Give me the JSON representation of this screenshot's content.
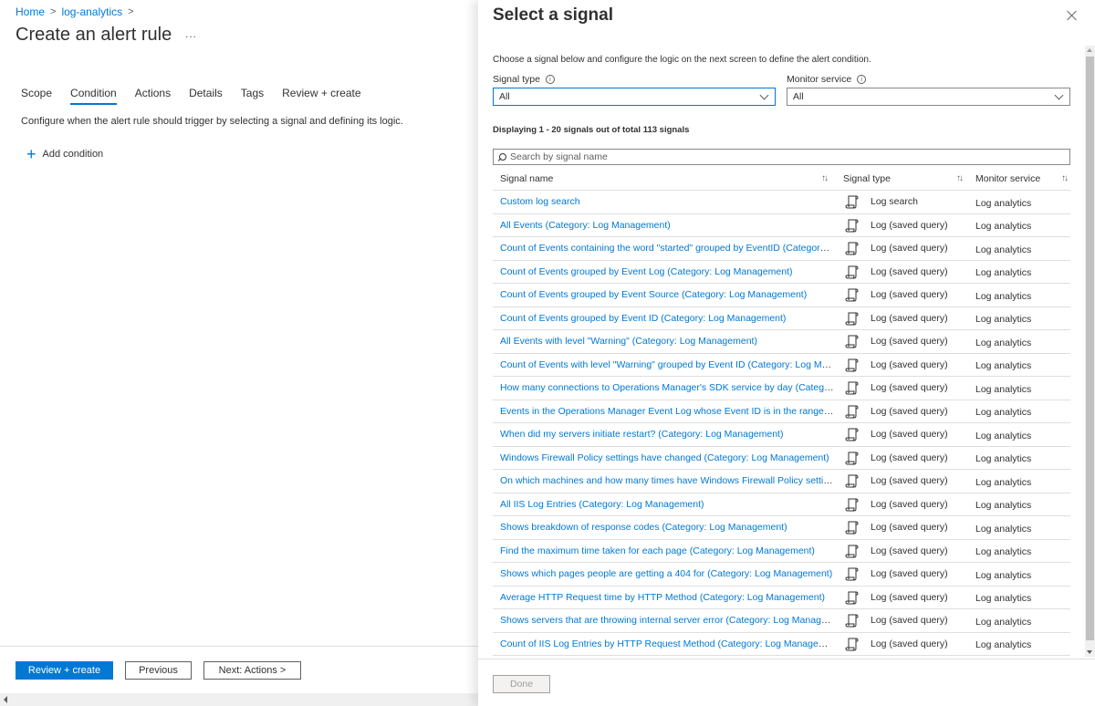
{
  "breadcrumb": [
    {
      "label": "Home"
    },
    {
      "label": "log-analytics"
    }
  ],
  "page": {
    "title": "Create an alert rule",
    "more_label": "...",
    "tabs": [
      {
        "label": "Scope",
        "active": false
      },
      {
        "label": "Condition",
        "active": true
      },
      {
        "label": "Actions",
        "active": false
      },
      {
        "label": "Details",
        "active": false
      },
      {
        "label": "Tags",
        "active": false
      },
      {
        "label": "Review + create",
        "active": false
      }
    ],
    "description": "Configure when the alert rule should trigger by selecting a signal and defining its logic.",
    "add_condition_label": "Add condition",
    "footer": {
      "review_create_label": "Review + create",
      "previous_label": "Previous",
      "next_label": "Next: Actions >"
    }
  },
  "panel": {
    "title": "Select a signal",
    "description": "Choose a signal below and configure the logic on the next screen to define the alert condition.",
    "signal_type": {
      "label": "Signal type",
      "value": "All"
    },
    "monitor_service": {
      "label": "Monitor service",
      "value": "All"
    },
    "count_text": "Displaying 1 - 20 signals out of total 113 signals",
    "search": {
      "placeholder": "Search by signal name",
      "value": ""
    },
    "columns": [
      "Signal name",
      "Signal type",
      "Monitor service"
    ],
    "rows": [
      {
        "name": "Custom log search",
        "type": "Log search",
        "service": "Log analytics"
      },
      {
        "name": "All Events (Category: Log Management)",
        "type": "Log (saved query)",
        "service": "Log analytics"
      },
      {
        "name": "Count of Events containing the word \"started\" grouped by EventID (Category: L...",
        "type": "Log (saved query)",
        "service": "Log analytics"
      },
      {
        "name": "Count of Events grouped by Event Log (Category: Log Management)",
        "type": "Log (saved query)",
        "service": "Log analytics"
      },
      {
        "name": "Count of Events grouped by Event Source (Category: Log Management)",
        "type": "Log (saved query)",
        "service": "Log analytics"
      },
      {
        "name": "Count of Events grouped by Event ID (Category: Log Management)",
        "type": "Log (saved query)",
        "service": "Log analytics"
      },
      {
        "name": "All Events with level \"Warning\" (Category: Log Management)",
        "type": "Log (saved query)",
        "service": "Log analytics"
      },
      {
        "name": "Count of Events with level \"Warning\" grouped by Event ID (Category: Log Man...",
        "type": "Log (saved query)",
        "service": "Log analytics"
      },
      {
        "name": "How many connections to Operations Manager's SDK service by day (Category:...",
        "type": "Log (saved query)",
        "service": "Log analytics"
      },
      {
        "name": "Events in the Operations Manager Event Log whose Event ID is in the range bet...",
        "type": "Log (saved query)",
        "service": "Log analytics"
      },
      {
        "name": "When did my servers initiate restart? (Category: Log Management)",
        "type": "Log (saved query)",
        "service": "Log analytics"
      },
      {
        "name": "Windows Firewall Policy settings have changed (Category: Log Management)",
        "type": "Log (saved query)",
        "service": "Log analytics"
      },
      {
        "name": "On which machines and how many times have Windows Firewall Policy settings...",
        "type": "Log (saved query)",
        "service": "Log analytics"
      },
      {
        "name": "All IIS Log Entries (Category: Log Management)",
        "type": "Log (saved query)",
        "service": "Log analytics"
      },
      {
        "name": "Shows breakdown of response codes (Category: Log Management)",
        "type": "Log (saved query)",
        "service": "Log analytics"
      },
      {
        "name": "Find the maximum time taken for each page (Category: Log Management)",
        "type": "Log (saved query)",
        "service": "Log analytics"
      },
      {
        "name": "Shows which pages people are getting a 404 for (Category: Log Management)",
        "type": "Log (saved query)",
        "service": "Log analytics"
      },
      {
        "name": "Average HTTP Request time by HTTP Method (Category: Log Management)",
        "type": "Log (saved query)",
        "service": "Log analytics"
      },
      {
        "name": "Shows servers that are throwing internal server error (Category: Log Managem...",
        "type": "Log (saved query)",
        "service": "Log analytics"
      },
      {
        "name": "Count of IIS Log Entries by HTTP Request Method (Category: Log Management)",
        "type": "Log (saved query)",
        "service": "Log analytics"
      }
    ],
    "done_label": "Done"
  },
  "colors": {
    "accent": "#0078d4",
    "text": "#323130",
    "border": "#e1dfdd"
  }
}
